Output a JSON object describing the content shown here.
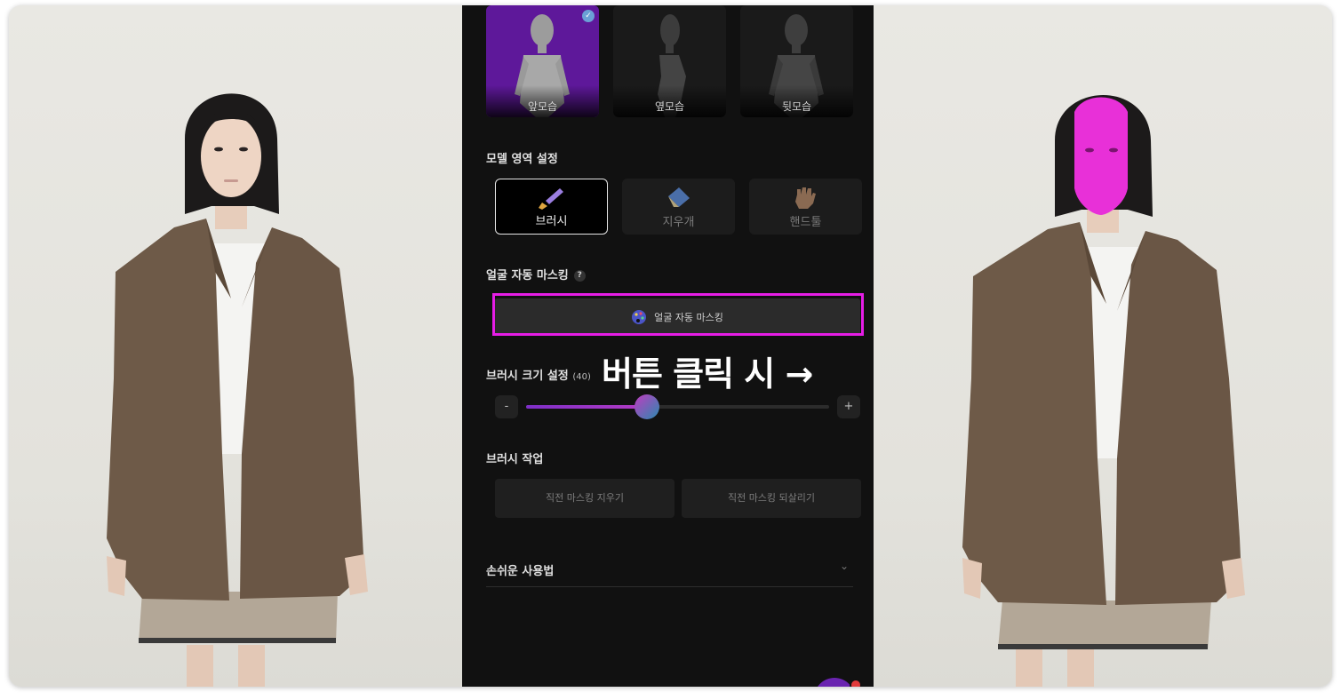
{
  "poses": [
    {
      "label": "앞모습",
      "selected": true
    },
    {
      "label": "옆모습",
      "selected": false
    },
    {
      "label": "뒷모습",
      "selected": false
    }
  ],
  "model_area": {
    "title": "모델 영역 설정",
    "tools": [
      {
        "label": "브러시",
        "icon": "paintbrush-icon",
        "active": true
      },
      {
        "label": "지우개",
        "icon": "eraser-icon",
        "active": false
      },
      {
        "label": "핸드툴",
        "icon": "hand-icon",
        "active": false
      }
    ]
  },
  "face_masking": {
    "title": "얼굴 자동 마스킹",
    "help": "?",
    "button_label": "얼굴 자동 마스킹",
    "button_icon": "palette-icon"
  },
  "callout_text": "버튼 클릭 시 →",
  "brush_size": {
    "title": "브러시 크기 설정",
    "value_text": "(40)",
    "value": 40,
    "range": [
      0,
      100
    ],
    "minus": "-",
    "plus": "+"
  },
  "brush_actions": {
    "title": "브러시 작업",
    "undo_label": "직전 마스킹 지우기",
    "redo_label": "직전 마스킹 되살리기"
  },
  "guide": {
    "title": "손쉬운 사용법"
  },
  "colors": {
    "highlight": "#e61de6",
    "face_mask": "#e830d8",
    "pose_selected": "#5e189a",
    "panel_bg": "#111111"
  }
}
